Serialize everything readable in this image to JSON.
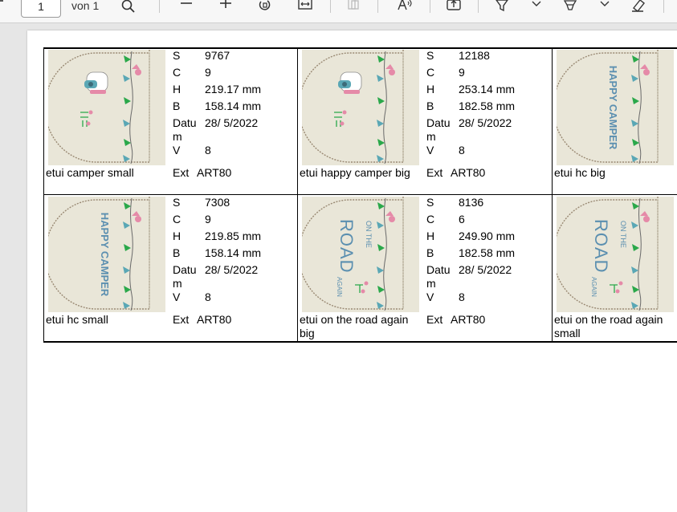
{
  "toolbar": {
    "page_number": "1",
    "page_of": "von 1",
    "icons": [
      "search-icon",
      "zoom-out-icon",
      "zoom-in-icon",
      "rotate-icon",
      "fit-width-icon",
      "page-view-icon",
      "read-aloud-icon",
      "export-icon",
      "highlight-icon",
      "chevron-down-icon",
      "draw-icon",
      "chevron-down-icon",
      "eraser-icon"
    ]
  },
  "labels": {
    "s": "S",
    "c": "C",
    "h": "H",
    "b": "B",
    "datum": "Datu m",
    "v": "V",
    "ext": "Ext"
  },
  "cells": [
    {
      "name": "etui camper small",
      "s": "9767",
      "c": "9",
      "h": "219.17 mm",
      "b": "158.14 mm",
      "datum": "28/ 5/2022",
      "v": "8",
      "ext": "ART80",
      "design": "camper"
    },
    {
      "name": "etui happy camper big",
      "s": "12188",
      "c": "9",
      "h": "253.14 mm",
      "b": "182.58 mm",
      "datum": "28/ 5/2022",
      "v": "8",
      "ext": "ART80",
      "design": "camper"
    },
    {
      "name": "etui hc big",
      "design": "happy-camper-text",
      "thumb_text": "HAPPY CAMPER"
    },
    {
      "name": "etui hc small",
      "s": "7308",
      "c": "9",
      "h": "219.85 mm",
      "b": "158.14 mm",
      "datum": "28/ 5/2022",
      "v": "8",
      "ext": "ART80",
      "design": "happy-camper-text",
      "thumb_text": "HAPPY CAMPER"
    },
    {
      "name": "etui on the road again big",
      "s": "8136",
      "c": "6",
      "h": "249.90 mm",
      "b": "182.58 mm",
      "datum": "28/ 5/2022",
      "v": "8",
      "ext": "ART80",
      "design": "road-text",
      "thumb_text": [
        "ON THE",
        "ROAD",
        "AGAIN"
      ]
    },
    {
      "name": "etui on the road again small",
      "design": "road-text",
      "thumb_text": [
        "ON THE",
        "ROAD",
        "AGAIN"
      ]
    }
  ],
  "colors": {
    "fabric": "#e9e6d8",
    "stitch": "#9a8a74",
    "flag_green": "#2aa84a",
    "flag_teal": "#5aa7b5",
    "text_blue": "#5b8fb0",
    "pink": "#e58aa8"
  }
}
